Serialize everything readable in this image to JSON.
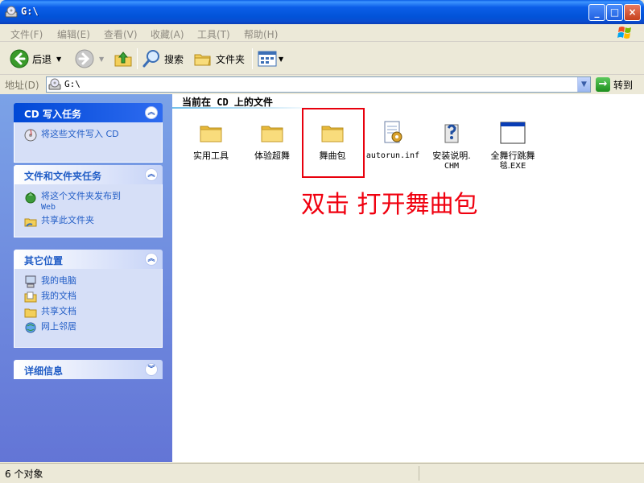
{
  "window": {
    "title": "G:\\",
    "minimize": "_",
    "maximize": "□",
    "close": "×"
  },
  "menu": {
    "items": [
      "文件(F)",
      "编辑(E)",
      "查看(V)",
      "收藏(A)",
      "工具(T)",
      "帮助(H)"
    ]
  },
  "toolbar": {
    "back_label": "后退",
    "search_label": "搜索",
    "folders_label": "文件夹"
  },
  "address": {
    "label": "地址(D)",
    "value": "G:\\",
    "go_label": "转到"
  },
  "taskpane": {
    "groups": [
      {
        "title": "CD 写入任务",
        "tasks": [
          {
            "label": "将这些文件写入 CD",
            "icon": "cd-burn-icon"
          }
        ]
      },
      {
        "title": "文件和文件夹任务",
        "tasks": [
          {
            "label": "将这个文件夹发布到",
            "sub": "Web",
            "icon": "publish-web-icon"
          },
          {
            "label": "共享此文件夹",
            "icon": "share-folder-icon"
          }
        ]
      },
      {
        "title": "其它位置",
        "tasks": [
          {
            "label": "我的电脑",
            "icon": "my-computer-icon"
          },
          {
            "label": "我的文档",
            "icon": "my-documents-icon"
          },
          {
            "label": "共享文档",
            "icon": "shared-documents-icon"
          },
          {
            "label": "网上邻居",
            "icon": "network-places-icon"
          }
        ]
      },
      {
        "title": "详细信息",
        "tasks": []
      }
    ]
  },
  "main": {
    "section_title": "当前在 CD 上的文件",
    "files": [
      {
        "name": "实用工具",
        "icon": "folder-icon"
      },
      {
        "name": "体验超舞",
        "icon": "folder-icon"
      },
      {
        "name": "舞曲包",
        "icon": "folder-icon"
      },
      {
        "name": "autorun.inf",
        "icon": "config-file-icon"
      },
      {
        "name": "安装说明.",
        "name2": "CHM",
        "icon": "help-file-icon"
      },
      {
        "name": "全舞行跳舞",
        "name2": "毯.EXE",
        "icon": "exe-window-icon"
      }
    ],
    "annotation": "双击 打开舞曲包"
  },
  "status": {
    "text": "6 个对象"
  },
  "colors": {
    "highlight": "#e8000d",
    "title_bar": "#0253d8",
    "task_link": "#215dc6"
  }
}
